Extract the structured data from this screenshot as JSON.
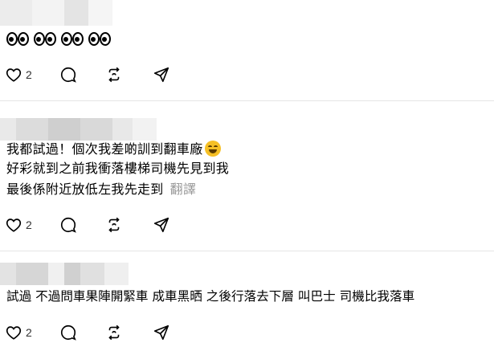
{
  "posts": [
    {
      "text_lines": [
        "👀👀👀👀"
      ],
      "likes": "2"
    },
    {
      "text_lines": [
        "我都試過！個次我差啲訓到翻車廠",
        "好彩就到之前我衝落樓梯司機先見到我",
        "最後係附近放低左我先走到"
      ],
      "translate_label": "翻譯",
      "likes": "2"
    },
    {
      "text_lines": [
        "試過 不過問車果陣開緊車 成車黑晒 之後行落去下層 叫巴士 司機比我落車"
      ],
      "likes": "2"
    }
  ],
  "icons": {
    "like": "heart-icon",
    "reply": "comment-icon",
    "repost": "repost-icon",
    "share": "send-icon"
  }
}
